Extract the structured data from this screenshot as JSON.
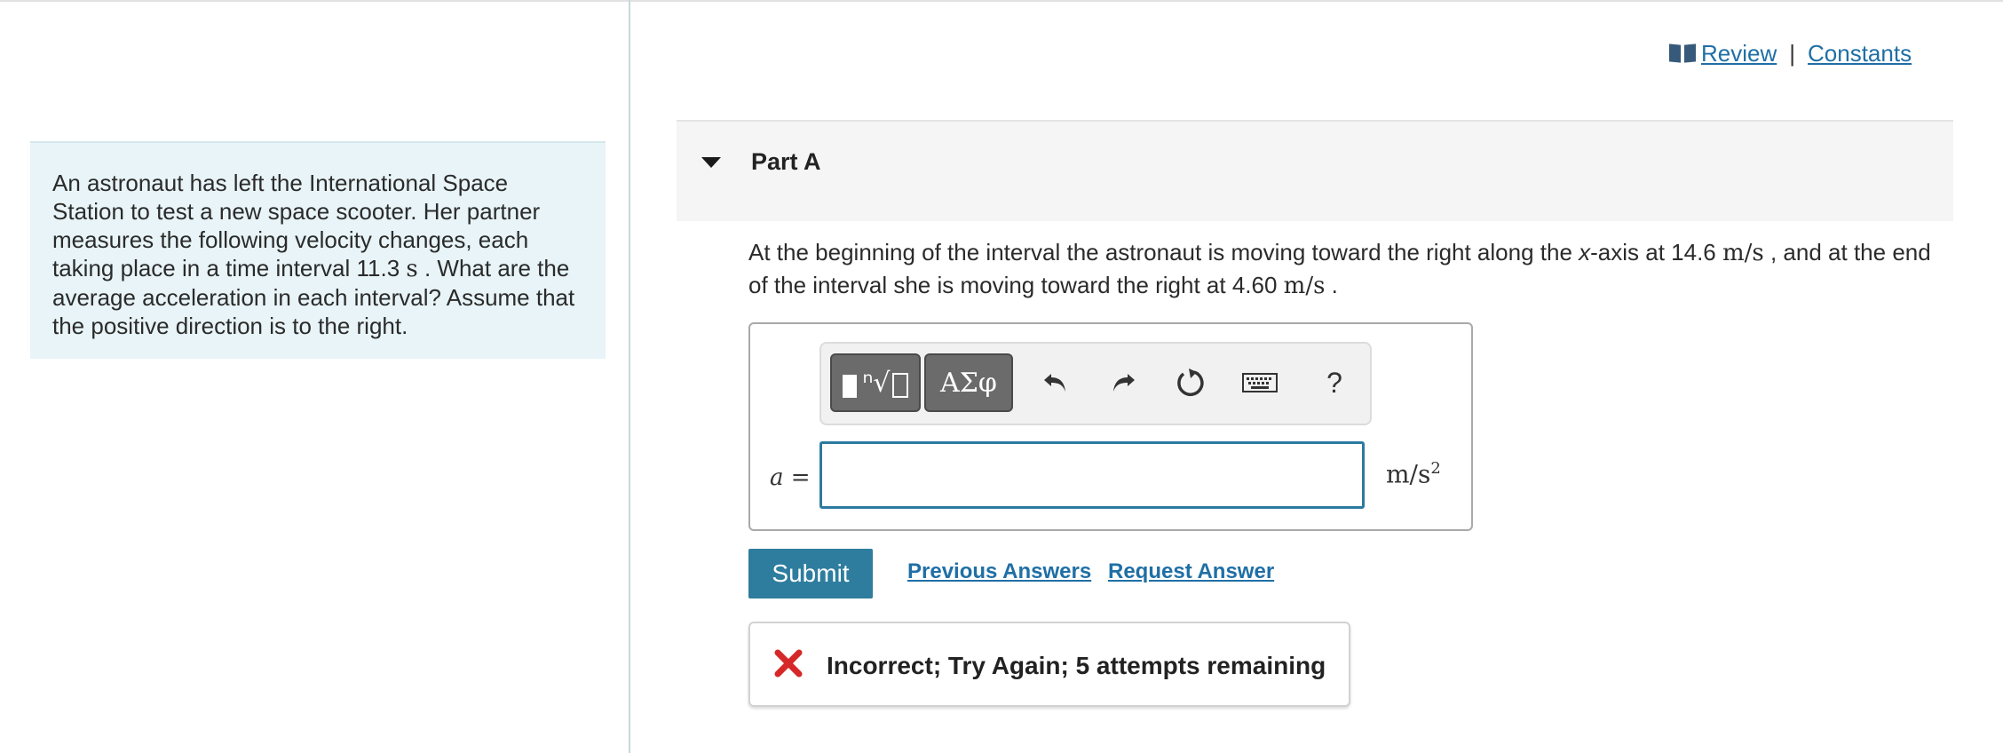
{
  "header_links": {
    "review": "Review",
    "separator": "|",
    "constants": "Constants"
  },
  "intro": {
    "line1": "An astronaut has left the International Space",
    "line2": "Station to test a new space scooter. Her partner",
    "line3": "measures the following velocity changes, each",
    "line4_a": "taking place in a time interval 11.3 ",
    "line4_unit": "s",
    "line4_b": " . What are the",
    "line5": "average acceleration in each interval? Assume that",
    "line6": "the positive direction is to the right."
  },
  "part": {
    "title": "Part A",
    "q_a": "At the beginning of the interval the astronaut is moving toward the right along the ",
    "q_axis": "x",
    "q_b": "-axis at 14.6 ",
    "q_unit1": "m/s",
    "q_c": " , and at the end of the interval she is moving toward the right at 4.60 ",
    "q_unit2": "m/s",
    "q_d": " ."
  },
  "toolbar": {
    "greek_label": "ΑΣφ",
    "help_label": "?"
  },
  "answer": {
    "var_label": "a",
    "equals": " =",
    "value": "",
    "unit": "m/s",
    "unit_exp": "2"
  },
  "actions": {
    "submit": "Submit",
    "previous_answers": "Previous Answers",
    "request_answer": "Request Answer"
  },
  "feedback": {
    "message": "Incorrect; Try Again; 5 attempts remaining"
  },
  "colors": {
    "accent": "#2e7d9e",
    "link": "#1f6fa5",
    "error": "#d62828",
    "panel": "#e8f4f7"
  }
}
